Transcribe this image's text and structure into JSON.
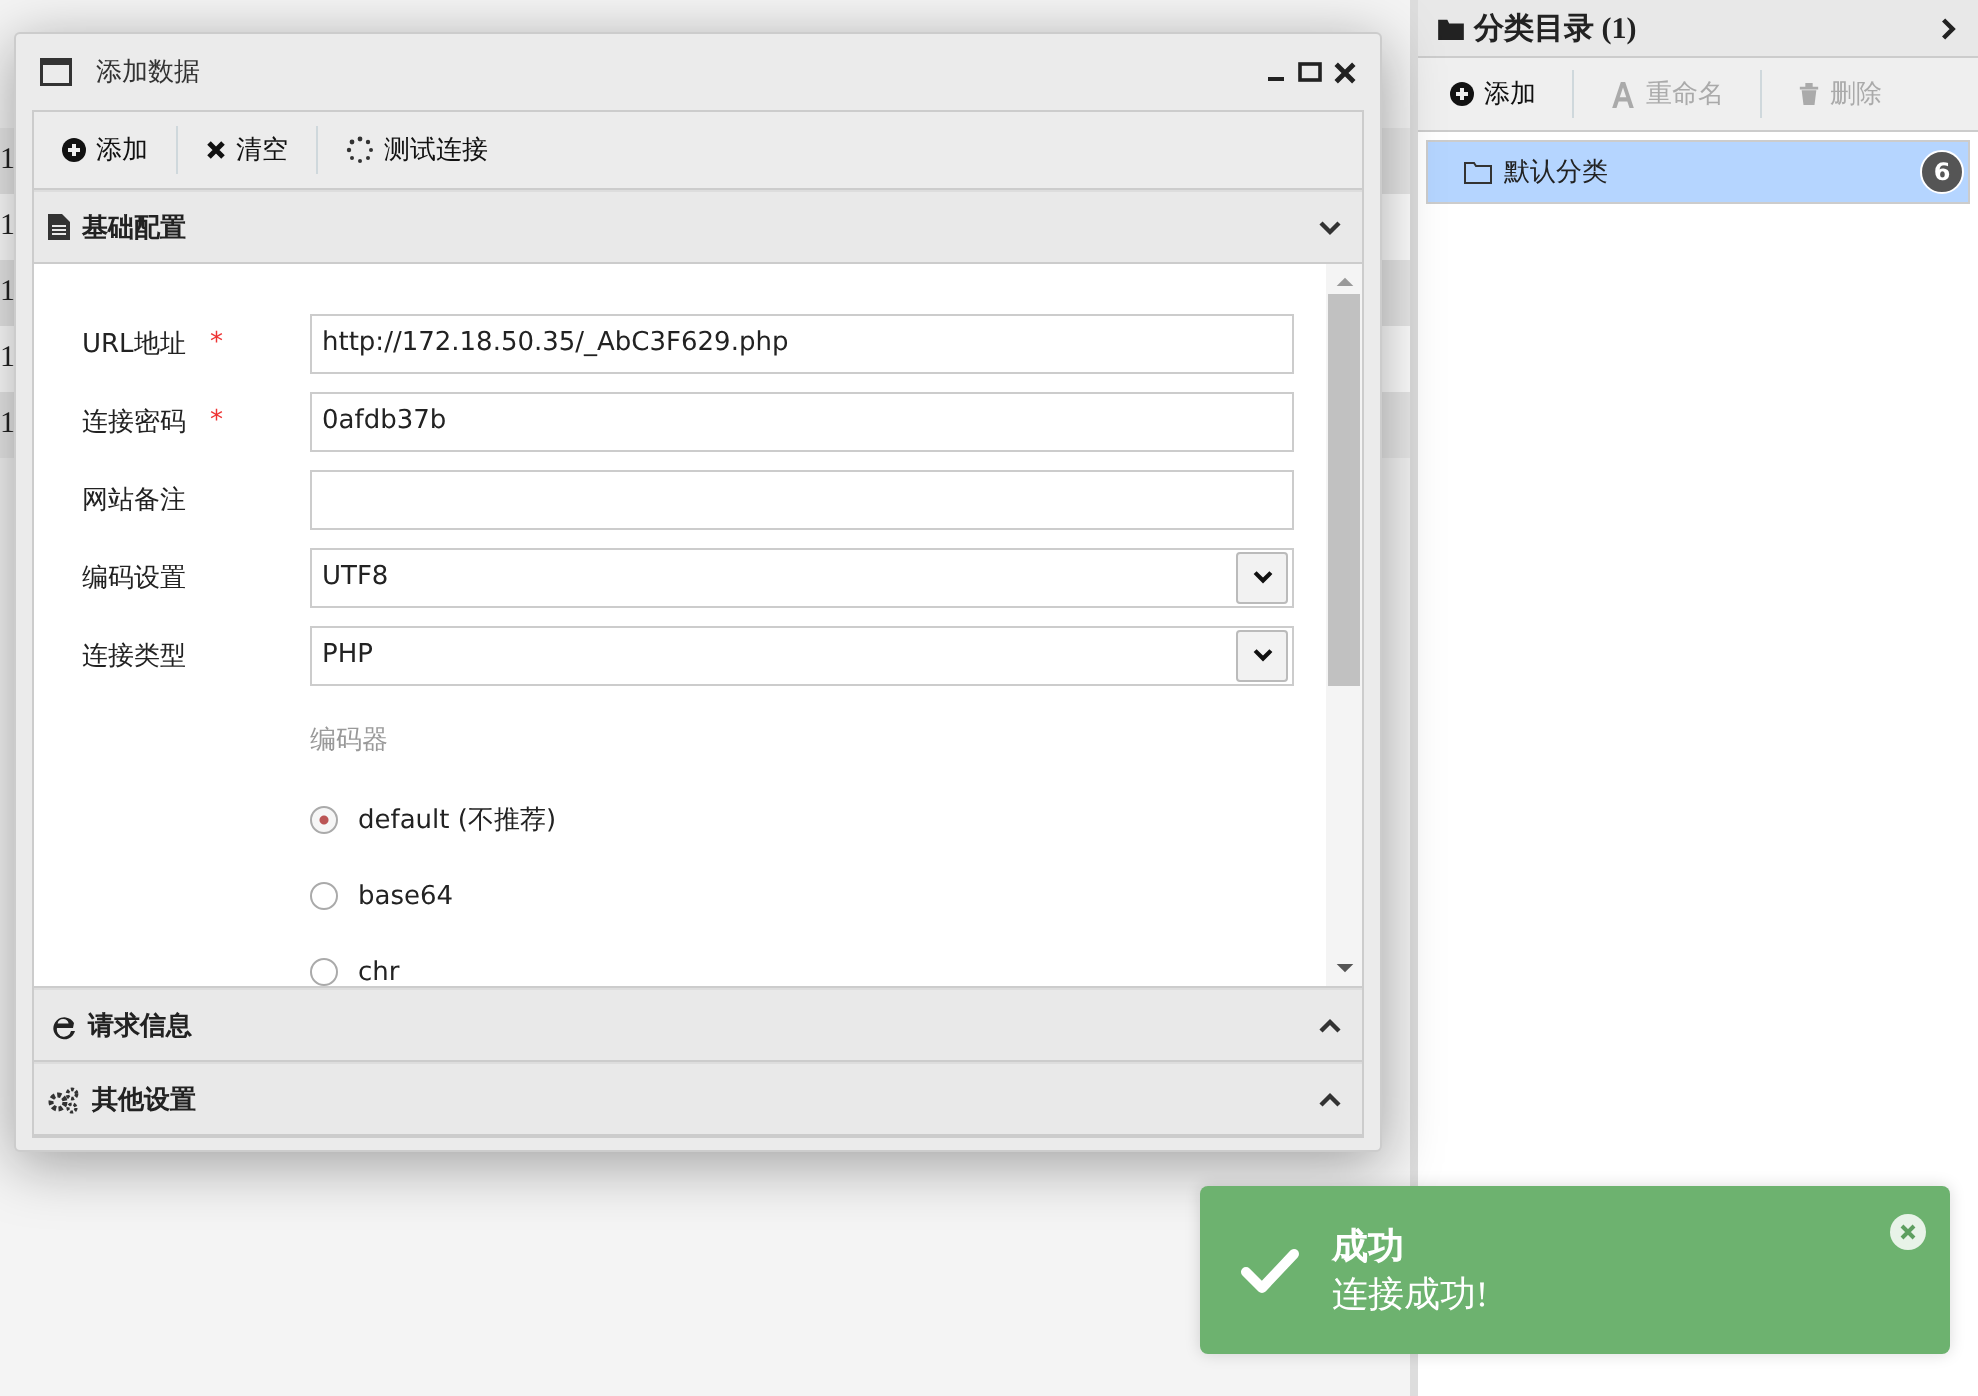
{
  "background_table": {
    "rows": [
      "1",
      "1",
      "1",
      "1",
      "1"
    ]
  },
  "category_panel": {
    "title": "分类目录 (1)",
    "toolbar": [
      {
        "label": "添加",
        "disabled": false
      },
      {
        "label": "重命名",
        "disabled": true
      },
      {
        "label": "删除",
        "disabled": true
      }
    ],
    "items": [
      {
        "label": "默认分类",
        "count": "6",
        "selected": true
      }
    ]
  },
  "dialog": {
    "title": "添加数据",
    "toolbar": [
      {
        "label": "添加"
      },
      {
        "label": "清空"
      },
      {
        "label": "测试连接"
      }
    ],
    "sections": [
      {
        "title": "基础配置",
        "expanded": true
      },
      {
        "title": "请求信息",
        "expanded": false
      },
      {
        "title": "其他设置",
        "expanded": false
      }
    ],
    "fields": [
      {
        "label": "URL地址",
        "required_mark": "*",
        "kind": "text",
        "value": "http://172.18.50.35/_AbC3F629.php"
      },
      {
        "label": "连接密码",
        "required_mark": "*",
        "kind": "text",
        "value": "0afdb37b"
      },
      {
        "label": "网站备注",
        "kind": "text"
      },
      {
        "label": "编码设置",
        "kind": "select",
        "value": "UTF8"
      },
      {
        "label": "连接类型",
        "kind": "select",
        "value": "PHP"
      }
    ],
    "encoder_title": "编码器",
    "encoders": [
      {
        "label": "default (不推荐)",
        "selected": true
      },
      {
        "label": "base64",
        "selected": false
      },
      {
        "label": "chr",
        "selected": false
      }
    ]
  },
  "toast": {
    "title": "成功",
    "message": "连接成功!"
  }
}
